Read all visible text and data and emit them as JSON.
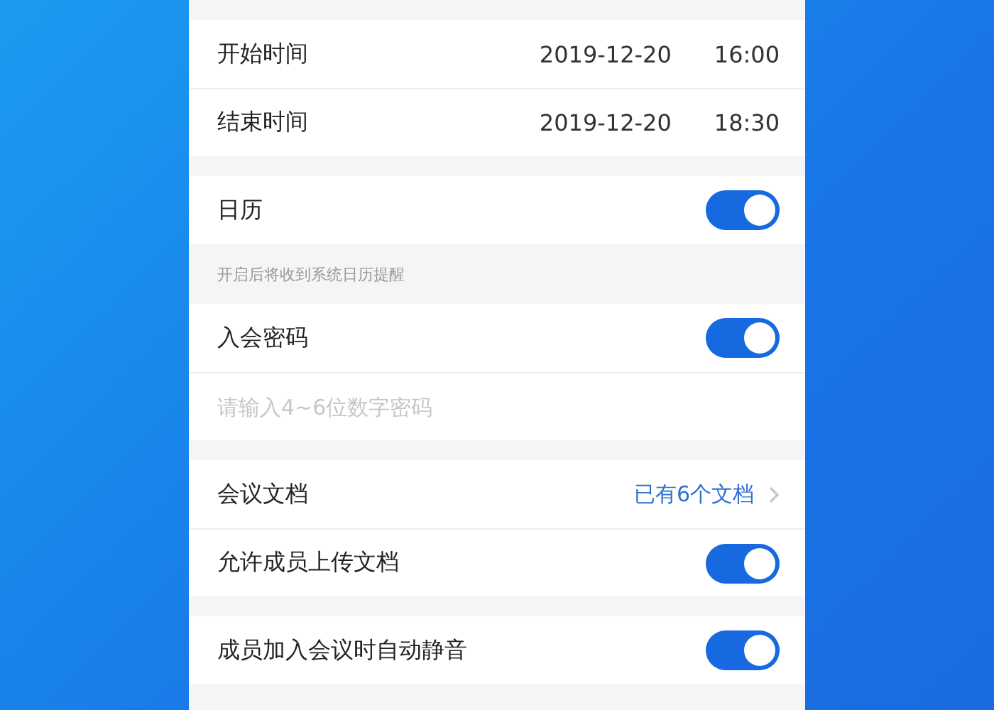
{
  "time_rows": [
    {
      "label": "开始时间",
      "date": "2019-12-20",
      "time": "16:00"
    },
    {
      "label": "结束时间",
      "date": "2019-12-20",
      "time": "18:30"
    }
  ],
  "calendar": {
    "label": "日历",
    "on": true,
    "hint": "开启后将收到系统日历提醒"
  },
  "password": {
    "label": "入会密码",
    "on": true,
    "placeholder": "请输入4~6位数字密码"
  },
  "documents": {
    "label": "会议文档",
    "value": "已有6个文档"
  },
  "upload": {
    "label": "允许成员上传文档",
    "on": true
  },
  "mute": {
    "label": "成员加入会议时自动静音",
    "on": true
  }
}
